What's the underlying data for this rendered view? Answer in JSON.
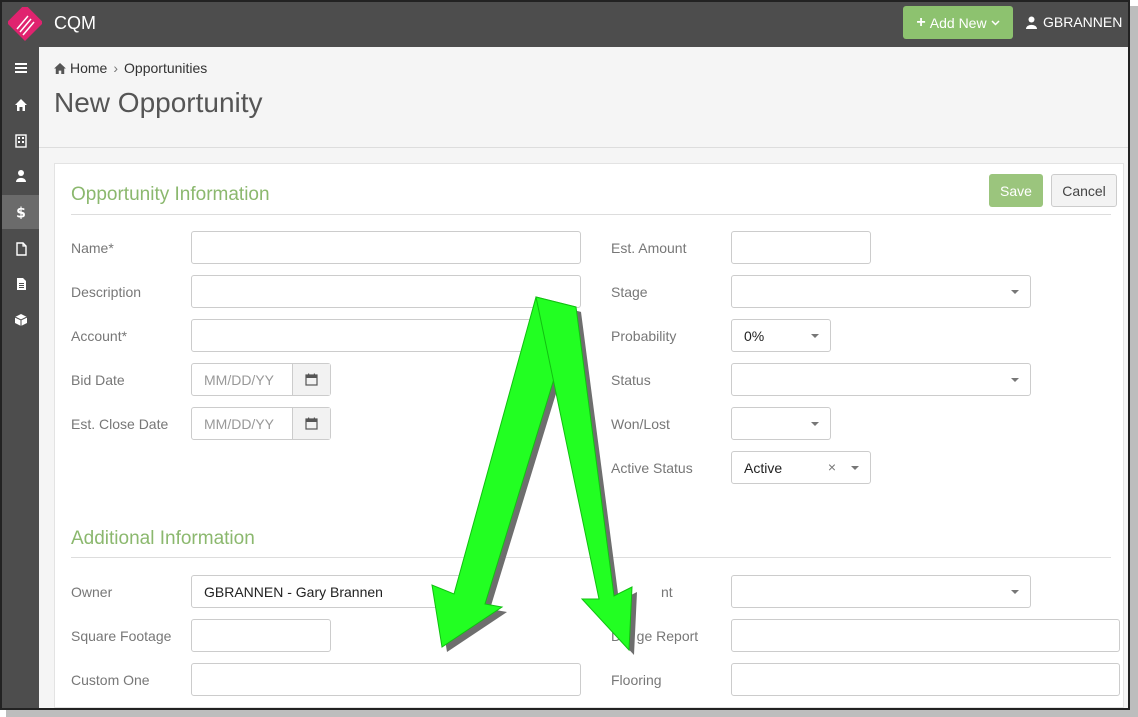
{
  "topbar": {
    "app_title": "CQM",
    "add_new_label": "Add New",
    "user_name": "GBRANNEN"
  },
  "sidebar": {
    "items": [
      {
        "icon": "menu-icon"
      },
      {
        "icon": "home-icon"
      },
      {
        "icon": "building-icon"
      },
      {
        "icon": "user-icon"
      },
      {
        "icon": "dollar-icon",
        "active": true
      },
      {
        "icon": "file-icon"
      },
      {
        "icon": "document-icon"
      },
      {
        "icon": "cube-icon"
      }
    ]
  },
  "breadcrumb": {
    "home": "Home",
    "current": "Opportunities"
  },
  "page_title": "New Opportunity",
  "actions": {
    "save": "Save",
    "cancel": "Cancel"
  },
  "opportunity_info": {
    "title": "Opportunity Information",
    "name": {
      "label": "Name*",
      "value": ""
    },
    "description": {
      "label": "Description",
      "value": ""
    },
    "account": {
      "label": "Account*",
      "value": ""
    },
    "bid_date": {
      "label": "Bid Date",
      "placeholder": "MM/DD/YY"
    },
    "close_date": {
      "label": "Est. Close Date",
      "placeholder": "MM/DD/YY"
    },
    "amount": {
      "label": "Est. Amount",
      "value": ""
    },
    "stage": {
      "label": "Stage",
      "value": ""
    },
    "probability": {
      "label": "Probability",
      "value": "0%"
    },
    "status": {
      "label": "Status",
      "value": ""
    },
    "won_lost": {
      "label": "Won/Lost",
      "value": ""
    },
    "active_status": {
      "label": "Active Status",
      "value": "Active"
    }
  },
  "additional_info": {
    "title": "Additional Information",
    "owner": {
      "label": "Owner",
      "value": "GBRANNEN - Gary Brannen"
    },
    "square_footage": {
      "label": "Square Footage",
      "value": ""
    },
    "custom_one": {
      "label": "Custom One",
      "value": ""
    },
    "right_select_label": "nt",
    "design_report_label": "De  ge Report",
    "flooring": {
      "label": "Flooring",
      "value": ""
    }
  },
  "colors": {
    "accent_green": "#8dc26f",
    "section_title": "#8bb86e",
    "annotation_arrow": "#22ff22",
    "topbar": "#4d4d4d"
  }
}
